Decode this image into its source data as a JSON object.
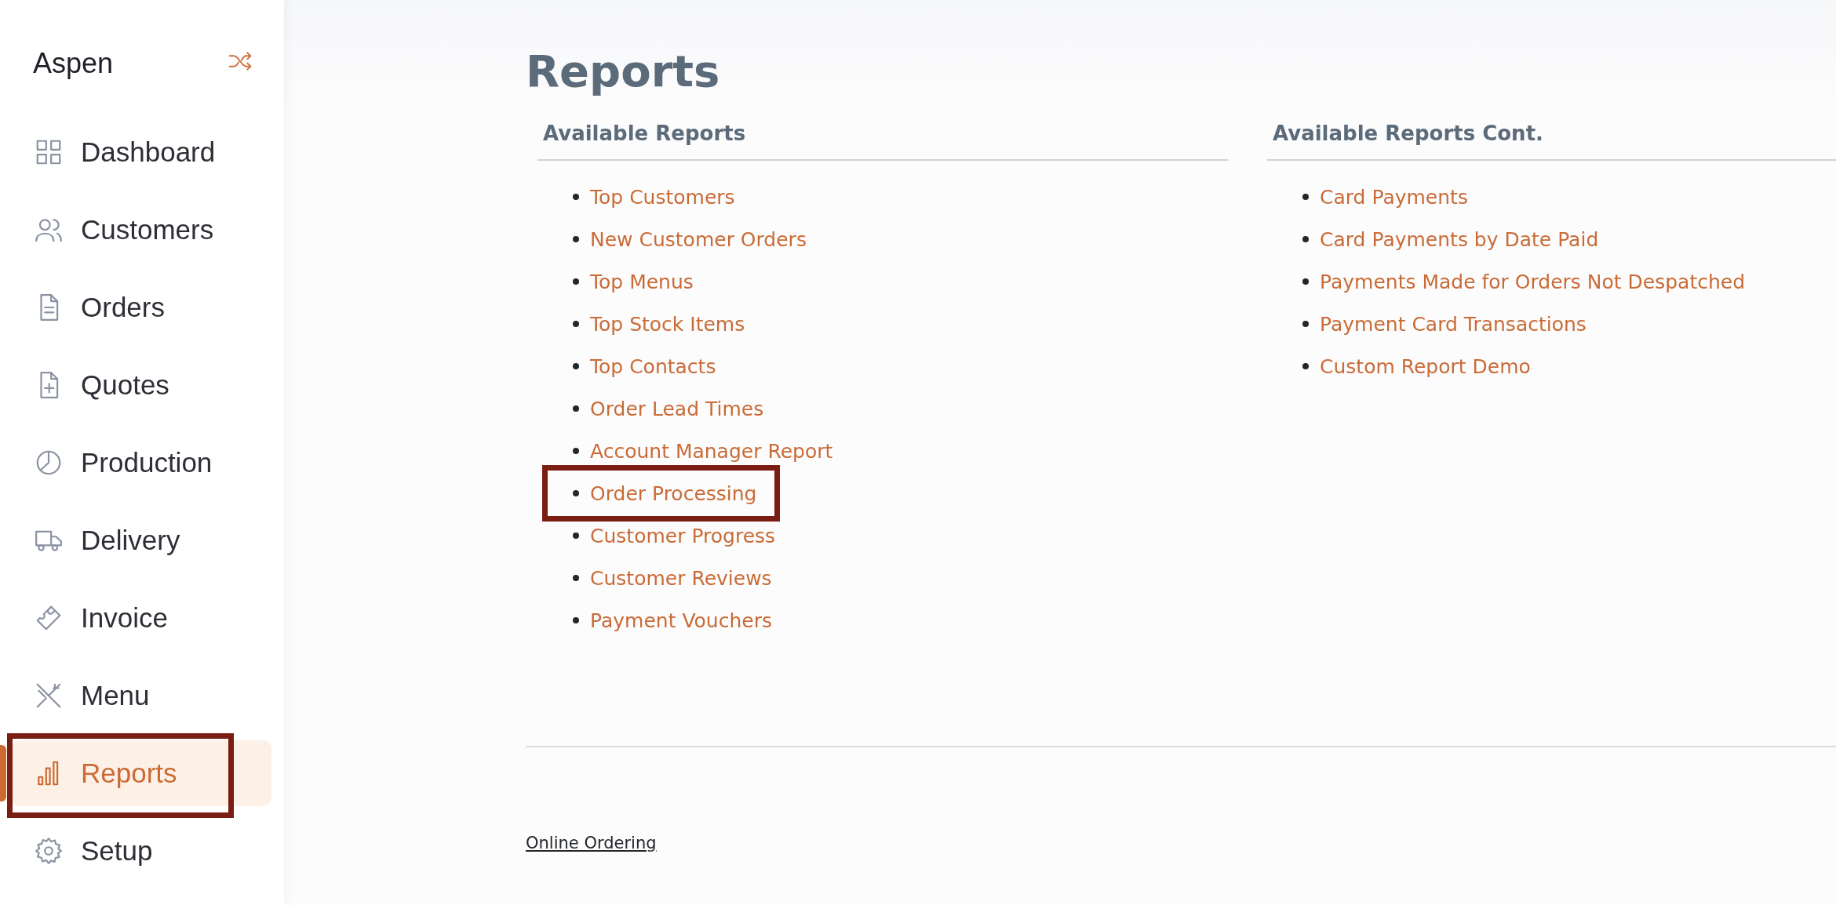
{
  "brand": {
    "name": "Aspen"
  },
  "sidebar": {
    "items": [
      {
        "label": "Dashboard",
        "selected": false,
        "highlighted": false
      },
      {
        "label": "Customers",
        "selected": false,
        "highlighted": false
      },
      {
        "label": "Orders",
        "selected": false,
        "highlighted": false
      },
      {
        "label": "Quotes",
        "selected": false,
        "highlighted": false
      },
      {
        "label": "Production",
        "selected": false,
        "highlighted": false
      },
      {
        "label": "Delivery",
        "selected": false,
        "highlighted": false
      },
      {
        "label": "Invoice",
        "selected": false,
        "highlighted": false
      },
      {
        "label": "Menu",
        "selected": false,
        "highlighted": false
      },
      {
        "label": "Reports",
        "selected": true,
        "highlighted": true
      },
      {
        "label": "Setup",
        "selected": false,
        "highlighted": false
      }
    ]
  },
  "page": {
    "title": "Reports"
  },
  "columns": [
    {
      "heading": "Available Reports",
      "links": [
        {
          "label": "Top Customers",
          "highlighted": false
        },
        {
          "label": "New Customer Orders",
          "highlighted": false
        },
        {
          "label": "Top Menus",
          "highlighted": false
        },
        {
          "label": "Top Stock Items",
          "highlighted": false
        },
        {
          "label": "Top Contacts",
          "highlighted": false
        },
        {
          "label": "Order Lead Times",
          "highlighted": false
        },
        {
          "label": "Account Manager Report",
          "highlighted": false
        },
        {
          "label": "Order Processing",
          "highlighted": true
        },
        {
          "label": "Customer Progress",
          "highlighted": false
        },
        {
          "label": "Customer Reviews",
          "highlighted": false
        },
        {
          "label": "Payment Vouchers",
          "highlighted": false
        }
      ]
    },
    {
      "heading": "Available Reports Cont.",
      "links": [
        {
          "label": "Card Payments",
          "highlighted": false
        },
        {
          "label": "Card Payments by Date Paid",
          "highlighted": false
        },
        {
          "label": "Payments Made for Orders Not Despatched",
          "highlighted": false
        },
        {
          "label": "Payment Card Transactions",
          "highlighted": false
        },
        {
          "label": "Custom Report Demo",
          "highlighted": false
        }
      ]
    }
  ],
  "footer": {
    "link": "Online Ordering"
  }
}
